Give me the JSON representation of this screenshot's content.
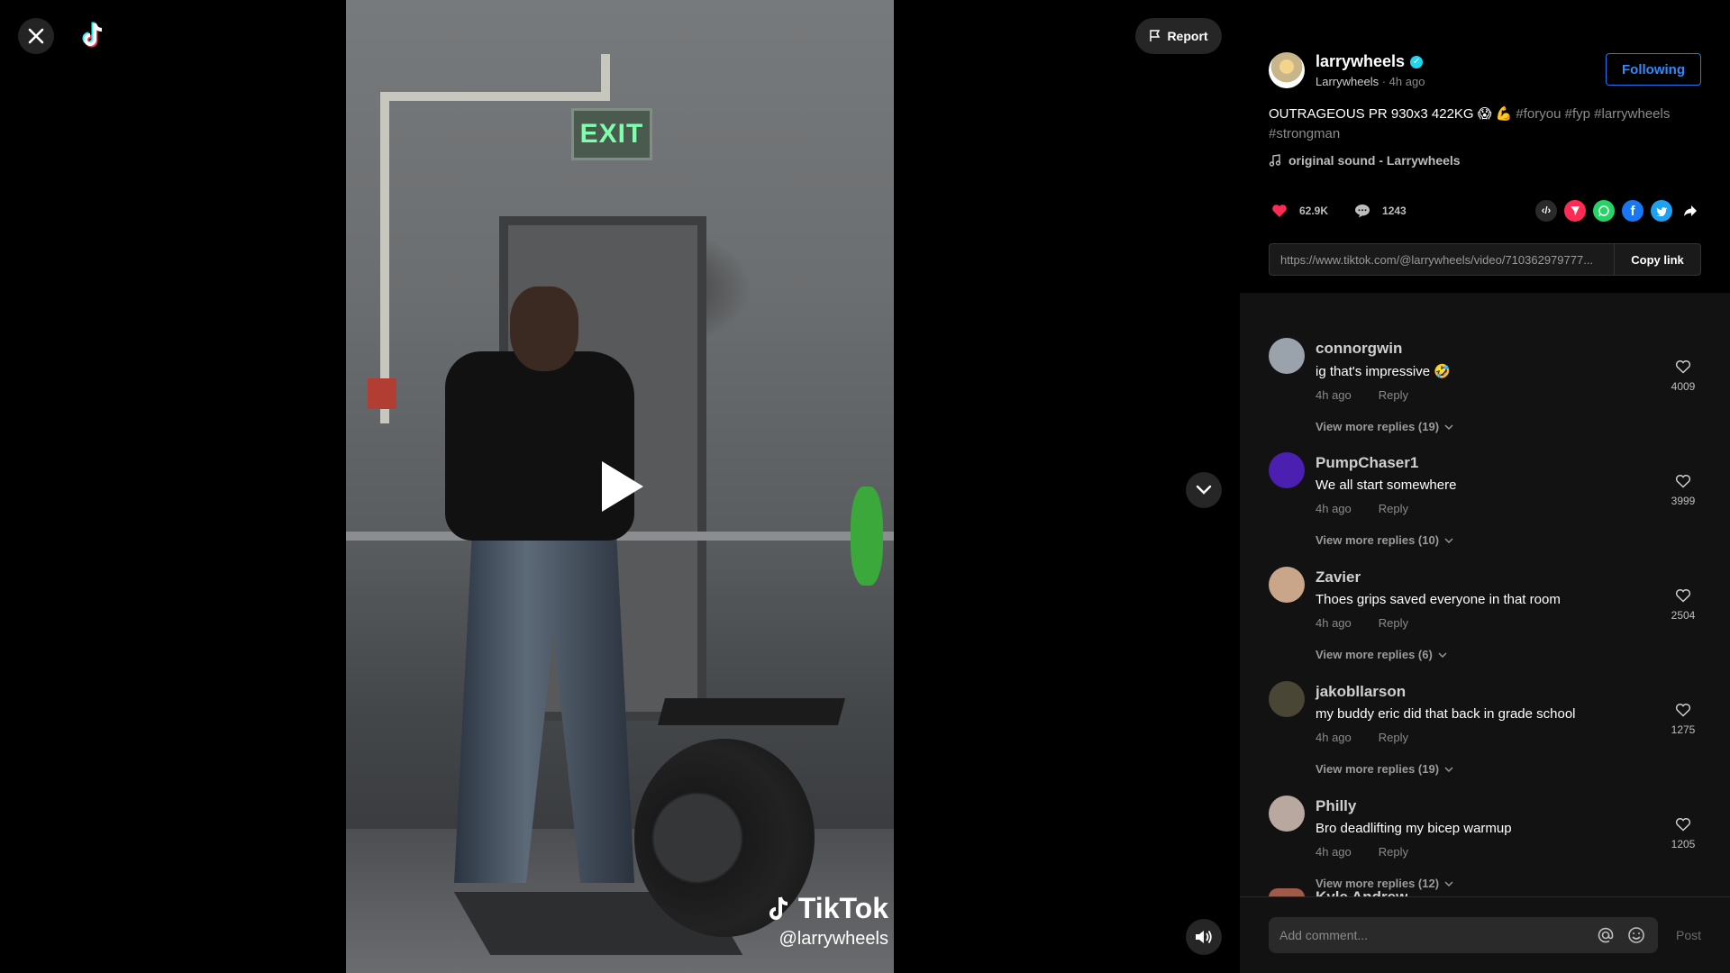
{
  "video": {
    "exit_sign": "EXIT",
    "watermark_brand": "TikTok",
    "watermark_handle": "@larrywheels"
  },
  "controls": {
    "report_label": "Report"
  },
  "author": {
    "username": "larrywheels",
    "display_name": "Larrywheels",
    "posted": "4h ago",
    "follow_label": "Following"
  },
  "caption": {
    "text": "OUTRAGEOUS PR 930x3 422KG 😱 💪",
    "tags": [
      "#foryou",
      "#fyp",
      "#larrywheels",
      "#strongman"
    ]
  },
  "sound": "original sound - Larrywheels",
  "stats": {
    "likes": "62.9K",
    "comments": "1243"
  },
  "share_icons": [
    "embed-icon",
    "send-icon",
    "whatsapp-icon",
    "facebook-icon",
    "twitter-icon",
    "share-icon"
  ],
  "link": {
    "url": "https://www.tiktok.com/@larrywheels/video/710362979777...",
    "copy_label": "Copy link"
  },
  "comments": [
    {
      "user": "connorgwin",
      "text": "ig that's impressive 🤣",
      "time": "4h ago",
      "reply": "Reply",
      "more": "View more replies (19)",
      "likes": "4009",
      "avatar_color": "#9aa3ab"
    },
    {
      "user": "PumpChaser1",
      "text": "We all start somewhere",
      "time": "4h ago",
      "reply": "Reply",
      "more": "View more replies (10)",
      "likes": "3999",
      "avatar_color": "#4b1fb0"
    },
    {
      "user": "Zavier",
      "text": "Thoes grips saved everyone in that room",
      "time": "4h ago",
      "reply": "Reply",
      "more": "View more replies (6)",
      "likes": "2504",
      "avatar_color": "#c9a58a"
    },
    {
      "user": "jakobllarson",
      "text": "my buddy eric did that back in grade school",
      "time": "4h ago",
      "reply": "Reply",
      "more": "View more replies (19)",
      "likes": "1275",
      "avatar_color": "#4a4636"
    },
    {
      "user": "Philly",
      "text": "Bro deadlifting my bicep warmup",
      "time": "4h ago",
      "reply": "Reply",
      "more": "View more replies (12)",
      "likes": "1205",
      "avatar_color": "#b8a8a0"
    }
  ],
  "partial_comment_user": "Kyle Andrew",
  "comment_input": {
    "placeholder": "Add comment...",
    "post_label": "Post"
  },
  "colors": {
    "accent_blue": "#2575f3",
    "like_red": "#fe2c55",
    "verified": "#20d5ec"
  }
}
